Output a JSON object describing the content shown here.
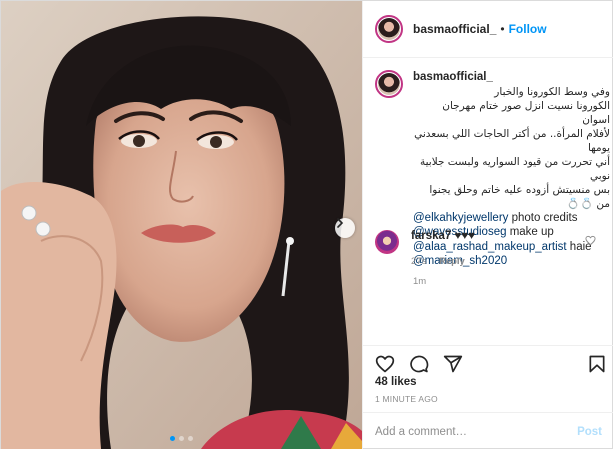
{
  "media": {
    "image_alt": "",
    "dots": [
      true,
      false,
      false
    ]
  },
  "header": {
    "username": "basmaofficial_",
    "separator": "•",
    "follow_label": "Follow"
  },
  "caption": {
    "username": "basmaofficial_",
    "arabic_lines": [
      "وفي وسط الكورونا والخبار",
      "الكورونا نسيت انزل صور ختام مهرجان اسوان",
      "لأفلام المرأة.. من أكتر الحاجات اللي بسعدني يومها",
      "أني تحررت من قيود السواريه ولبست جلابية نوبي",
      "بس منسيتش أزوده عليه خاتم وحلق يجنوا من 💍💍"
    ],
    "credits_1_mention": "@elkahkyjewellery",
    "credits_1_text": " photo credits",
    "credits_2_mention": "@wavesstudioseg",
    "credits_2_text": " make up",
    "credits_3_mention": "@alaa_rashad_makeup_artist",
    "credits_3_text": " haie",
    "credits_4_mention": "@mariam_sh2020",
    "time": "1m"
  },
  "comment": {
    "username": "farska7",
    "text": " ♥♥♥",
    "time": "27s",
    "reply_label": "Reply"
  },
  "actions": {
    "icons": [
      "heart-icon",
      "comment-icon",
      "share-icon",
      "bookmark-icon"
    ],
    "likes": "48 likes",
    "posted": "1 MINUTE AGO"
  },
  "add_comment": {
    "placeholder": "Add a comment…",
    "post_label": "Post"
  },
  "colors": {
    "accent": "#0095f6",
    "mention": "#00376b",
    "muted": "#8e8e8e",
    "post_disabled": "#b2dffc"
  }
}
